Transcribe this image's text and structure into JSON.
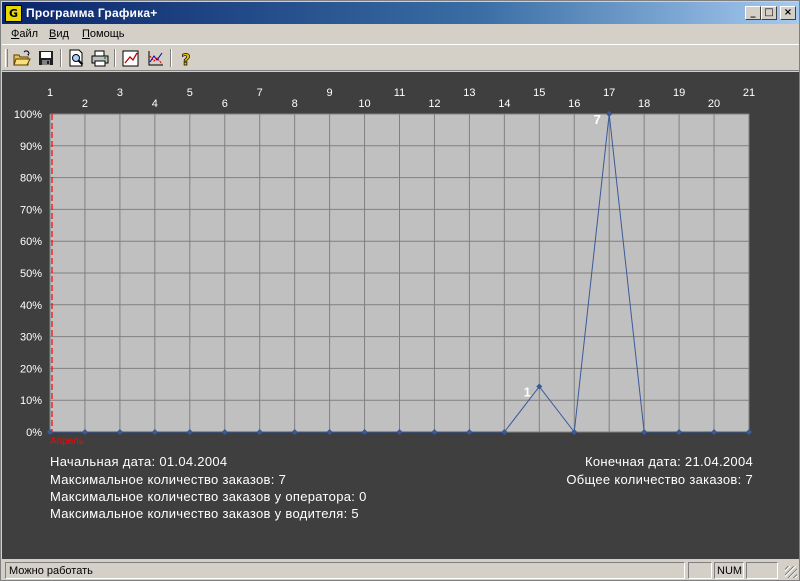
{
  "window": {
    "title": "Программа Графика+",
    "icon_letter": "G",
    "controls": {
      "minimize": "_",
      "maximize": "□",
      "close": "×"
    }
  },
  "menu": {
    "file": "Файл",
    "view": "Вид",
    "help": "Помощь"
  },
  "toolbar": {
    "items": [
      "open-icon",
      "save-icon",
      "print-preview-icon",
      "print-icon",
      "chart-icon",
      "graph-options-icon",
      "help-icon"
    ]
  },
  "colors": {
    "chart_background": "#3f3f3f",
    "plot_area": "#c0c0c0",
    "line": "#3a5a9a",
    "marker_line": "#ff0000"
  },
  "chart_data": {
    "type": "line",
    "x": [
      1,
      2,
      3,
      4,
      5,
      6,
      7,
      8,
      9,
      10,
      11,
      12,
      13,
      14,
      15,
      16,
      17,
      18,
      19,
      20,
      21
    ],
    "values": [
      0,
      0,
      0,
      0,
      0,
      0,
      0,
      0,
      0,
      0,
      0,
      0,
      0,
      0,
      1,
      0,
      7,
      0,
      0,
      0,
      0
    ],
    "y_percent": [
      0,
      0,
      0,
      0,
      0,
      0,
      0,
      0,
      0,
      0,
      0,
      0,
      0,
      0,
      14.3,
      0,
      100,
      0,
      0,
      0,
      0
    ],
    "point_labels": [
      {
        "x": 15,
        "text": "1"
      },
      {
        "x": 17,
        "text": "7"
      }
    ],
    "yticks": [
      "0%",
      "10%",
      "20%",
      "30%",
      "40%",
      "50%",
      "60%",
      "70%",
      "80%",
      "90%",
      "100%"
    ],
    "ylim": [
      0,
      100
    ],
    "grid": true,
    "month_marker": {
      "x": 1,
      "label": "Апрель"
    }
  },
  "info": {
    "start_date": "Начальная дата: 01.04.2004",
    "max_orders": "Максимальное количество заказов: 7",
    "max_orders_operator": "Максимальное количество заказов у оператора: 0",
    "max_orders_driver": "Максимальное количество заказов у водителя: 5",
    "end_date": "Конечная дата: 21.04.2004",
    "total_orders": "Общее количество заказов: 7"
  },
  "status": {
    "text": "Можно работать",
    "num": "NUM"
  }
}
